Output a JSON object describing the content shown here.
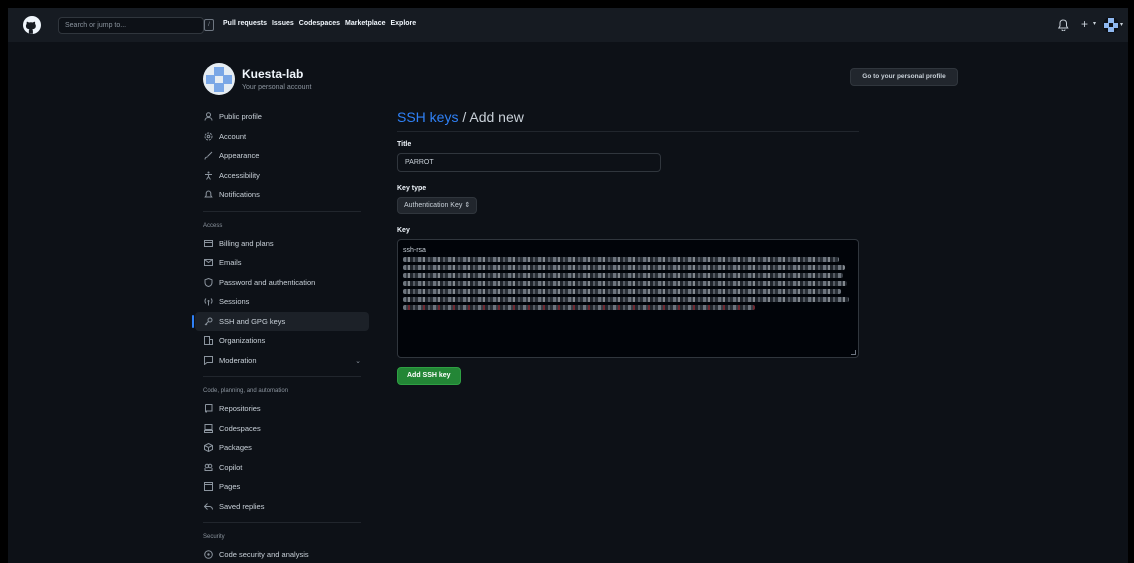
{
  "header": {
    "search_placeholder": "Search or jump to...",
    "slash_hint": "/",
    "nav": [
      "Pull requests",
      "Issues",
      "Codespaces",
      "Marketplace",
      "Explore"
    ],
    "plus_label": "+",
    "caret": "▾"
  },
  "account": {
    "name": "Kuesta-lab",
    "subtitle": "Your personal account",
    "profile_button": "Go to your personal profile"
  },
  "sidebar": {
    "top_items": [
      {
        "label": "Public profile",
        "icon": "person-icon"
      },
      {
        "label": "Account",
        "icon": "gear-icon"
      },
      {
        "label": "Appearance",
        "icon": "paintbrush-icon"
      },
      {
        "label": "Accessibility",
        "icon": "accessibility-icon"
      },
      {
        "label": "Notifications",
        "icon": "bell-icon"
      }
    ],
    "access_heading": "Access",
    "access_items": [
      {
        "label": "Billing and plans",
        "icon": "credit-card-icon"
      },
      {
        "label": "Emails",
        "icon": "mail-icon"
      },
      {
        "label": "Password and authentication",
        "icon": "shield-lock-icon"
      },
      {
        "label": "Sessions",
        "icon": "broadcast-icon"
      },
      {
        "label": "SSH and GPG keys",
        "icon": "key-icon"
      },
      {
        "label": "Organizations",
        "icon": "organization-icon"
      },
      {
        "label": "Moderation",
        "icon": "report-icon"
      }
    ],
    "code_heading": "Code, planning, and automation",
    "code_items": [
      {
        "label": "Repositories",
        "icon": "repo-icon"
      },
      {
        "label": "Codespaces",
        "icon": "codespaces-icon"
      },
      {
        "label": "Packages",
        "icon": "package-icon"
      },
      {
        "label": "Copilot",
        "icon": "copilot-icon"
      },
      {
        "label": "Pages",
        "icon": "browser-icon"
      },
      {
        "label": "Saved replies",
        "icon": "reply-icon"
      }
    ],
    "security_heading": "Security",
    "security_items": [
      {
        "label": "Code security and analysis",
        "icon": "codescan-icon"
      }
    ],
    "chevron": "⌄"
  },
  "main": {
    "title_crumb": "SSH keys",
    "title_rest": " / Add new",
    "title_label": "Title",
    "title_value": "PARROT",
    "key_type_label": "Key type",
    "key_type_value": "Authentication Key ⇕",
    "key_label": "Key",
    "key_first_line": "ssh-rsa",
    "add_button": "Add SSH key"
  },
  "colors": {
    "accent": "#2f81f7",
    "button_green": "#238636",
    "background": "#0d1117",
    "header": "#161b22"
  }
}
